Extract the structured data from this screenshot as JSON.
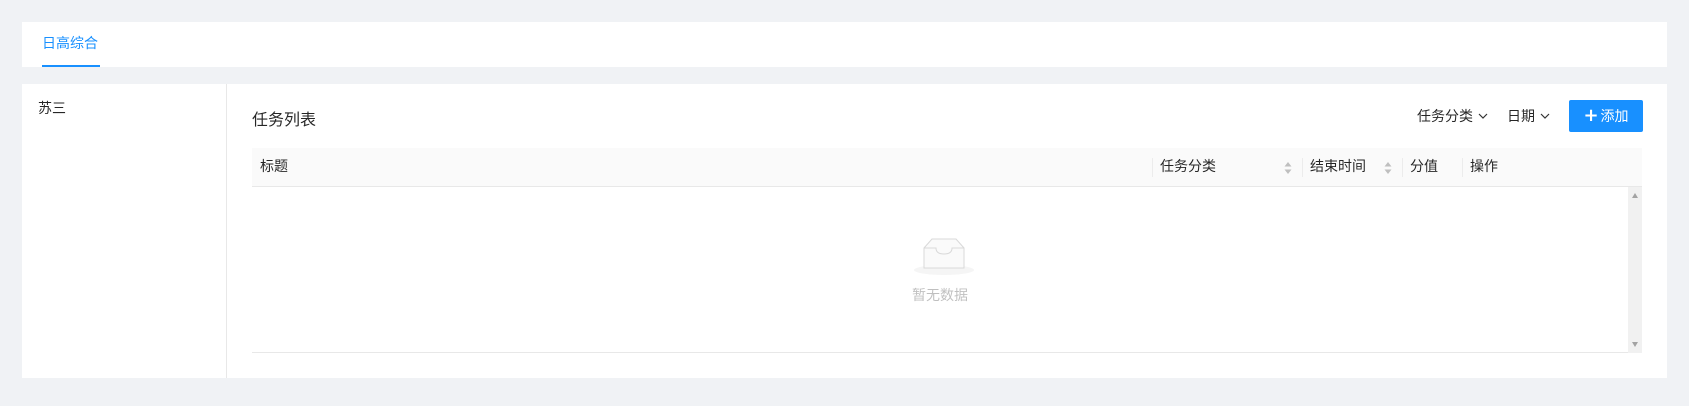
{
  "tabs": [
    {
      "label": "日高综合",
      "active": true
    }
  ],
  "users": [
    {
      "name": "苏三"
    }
  ],
  "task_list": {
    "title": "任务列表",
    "filters": {
      "category_label": "任务分类",
      "date_label": "日期"
    },
    "add_button": {
      "label": "添加",
      "icon": "plus-icon"
    },
    "table": {
      "columns": [
        {
          "label": "标题",
          "sortable": false
        },
        {
          "label": "任务分类",
          "sortable": true
        },
        {
          "label": "结束时间",
          "sortable": true
        },
        {
          "label": "分值",
          "sortable": false
        },
        {
          "label": "操作",
          "sortable": false
        }
      ],
      "rows": [],
      "empty_text": "暂无数据"
    }
  },
  "colors": {
    "accent": "#1890ff",
    "page_background": "#f0f2f5"
  }
}
